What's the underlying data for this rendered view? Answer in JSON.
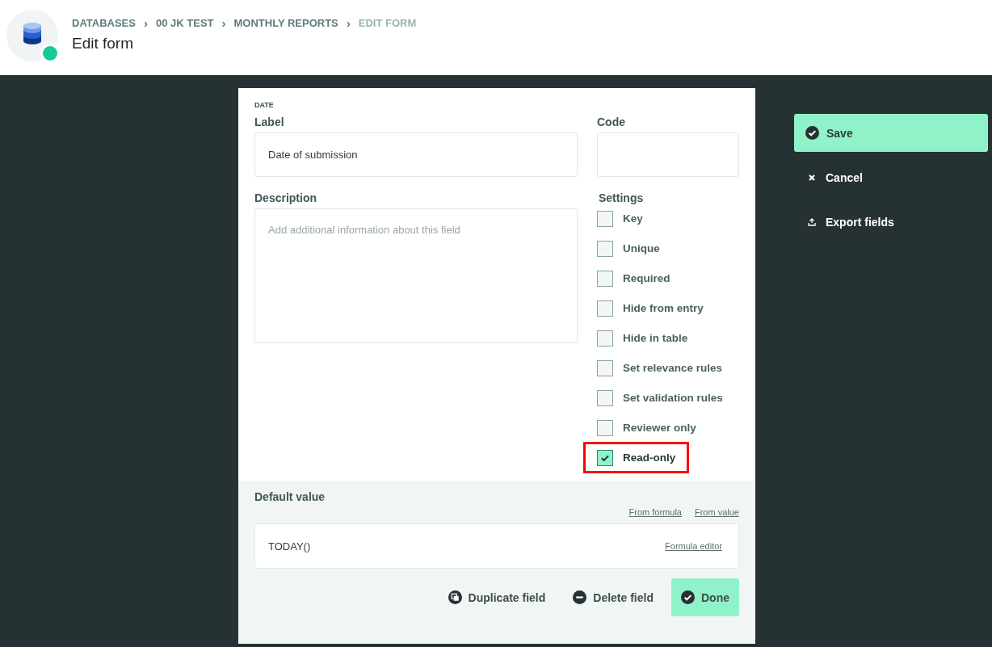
{
  "header": {
    "title": "Edit form",
    "breadcrumb": [
      {
        "label": "DATABASES",
        "current": false
      },
      {
        "label": "00 JK TEST",
        "current": false
      },
      {
        "label": "MONTHLY REPORTS",
        "current": false
      },
      {
        "label": "EDIT FORM",
        "current": true
      }
    ],
    "separator": "›"
  },
  "field": {
    "type_label": "DATE",
    "label": {
      "title": "Label",
      "value": "Date of submission"
    },
    "code": {
      "title": "Code"
    },
    "description": {
      "title": "Description",
      "placeholder": "Add additional information about this field"
    },
    "settings_title": "Settings",
    "settings": [
      {
        "label": "Key",
        "checked": false,
        "highlighted": false
      },
      {
        "label": "Unique",
        "checked": false,
        "highlighted": false
      },
      {
        "label": "Required",
        "checked": false,
        "highlighted": false
      },
      {
        "label": "Hide from entry",
        "checked": false,
        "highlighted": false
      },
      {
        "label": "Hide in table",
        "checked": false,
        "highlighted": false
      },
      {
        "label": "Set relevance rules",
        "checked": false,
        "highlighted": false
      },
      {
        "label": "Set validation rules",
        "checked": false,
        "highlighted": false
      },
      {
        "label": "Reviewer only",
        "checked": false,
        "highlighted": false
      },
      {
        "label": "Read-only",
        "checked": true,
        "highlighted": true
      }
    ]
  },
  "default_value": {
    "title": "Default value",
    "modes": [
      "From formula",
      "From value"
    ],
    "value": "TODAY()",
    "editor_link": "Formula editor"
  },
  "footer_buttons": [
    {
      "label": "Duplicate field",
      "kind": "duplicate",
      "primary": false
    },
    {
      "label": "Delete field",
      "kind": "delete",
      "primary": false
    },
    {
      "label": "Done",
      "kind": "check",
      "primary": true
    }
  ],
  "actions": [
    {
      "label": "Save",
      "kind": "check",
      "primary": true
    },
    {
      "label": "Cancel",
      "kind": "close",
      "primary": false
    },
    {
      "label": "Export fields",
      "kind": "export",
      "primary": false
    }
  ]
}
